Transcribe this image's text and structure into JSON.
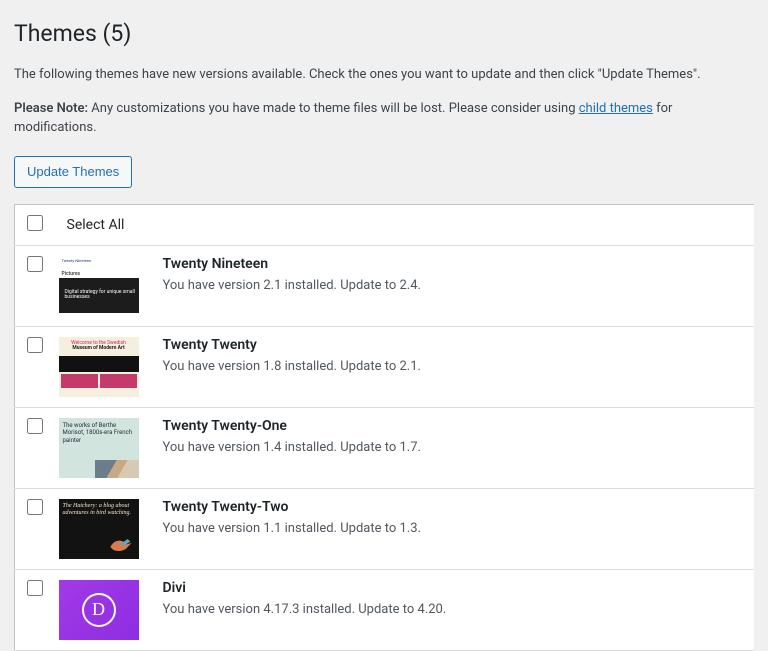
{
  "header": {
    "title": "Themes (5)"
  },
  "intro_text": "The following themes have new versions available. Check the ones you want to update and then click \"Update Themes\".",
  "note": {
    "label": "Please Note:",
    "before_link": " Any customizations you have made to theme files will be lost. Please consider using ",
    "link_text": "child themes",
    "after_link": " for modifications."
  },
  "buttons": {
    "update_themes": "Update Themes"
  },
  "select_all_label": "Select All",
  "themes": [
    {
      "name": "Twenty Nineteen",
      "desc": "You have version 2.1 installed. Update to 2.4."
    },
    {
      "name": "Twenty Twenty",
      "desc": "You have version 1.8 installed. Update to 2.1."
    },
    {
      "name": "Twenty Twenty-One",
      "desc": "You have version 1.4 installed. Update to 1.7."
    },
    {
      "name": "Twenty Twenty-Two",
      "desc": "You have version 1.1 installed. Update to 1.3."
    },
    {
      "name": "Divi",
      "desc": "You have version 4.17.3 installed. Update to 4.20."
    }
  ],
  "thumb_text": {
    "t2019_top": "Twenty Nineteen",
    "t2019_label": "Pictures",
    "t2019_hero": "Digital strategy for unique small businesses",
    "t2020_a": "Welcome to the Swedish",
    "t2020_b": "Museum of Modern Art",
    "t2021": "The works of Berthe Morisot, 1800s-era French painter",
    "t2022": "The Hatchery: a blog about adventures in bird watching.",
    "divi": "D"
  }
}
